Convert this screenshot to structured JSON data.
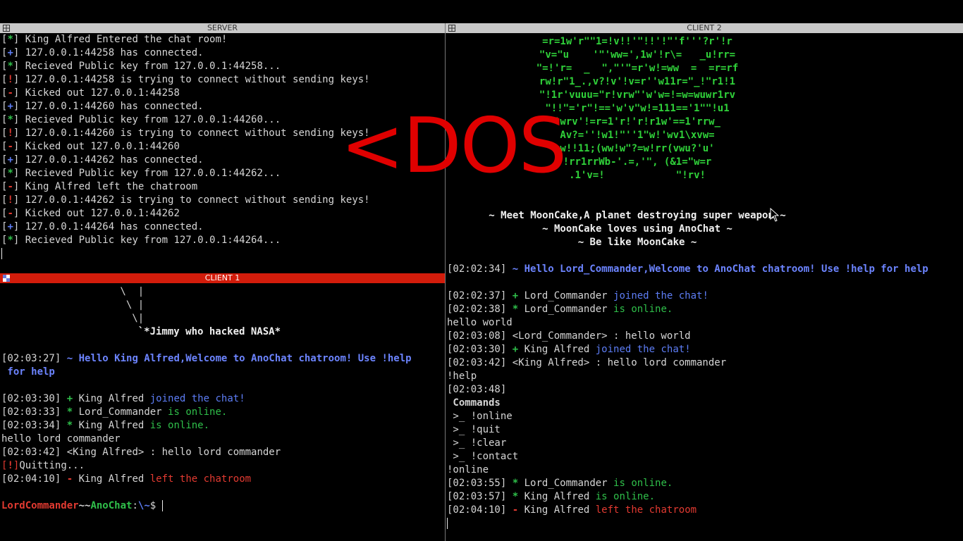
{
  "server": {
    "title": "SERVER",
    "lines": [
      {
        "tag": "*",
        "tag_color": "g",
        "text": "King Alfred Entered the chat room!"
      },
      {
        "tag": "+",
        "tag_color": "b",
        "text": "127.0.0.1:44258 has connected."
      },
      {
        "tag": "*",
        "tag_color": "g",
        "text": "Recieved Public key from 127.0.0.1:44258..."
      },
      {
        "tag": "!",
        "tag_color": "r",
        "text": "127.0.0.1:44258 is trying to connect without sending keys!"
      },
      {
        "tag": "-",
        "tag_color": "r",
        "text": "Kicked out 127.0.0.1:44258"
      },
      {
        "tag": "+",
        "tag_color": "b",
        "text": "127.0.0.1:44260 has connected."
      },
      {
        "tag": "*",
        "tag_color": "g",
        "text": "Recieved Public key from 127.0.0.1:44260..."
      },
      {
        "tag": "!",
        "tag_color": "r",
        "text": "127.0.0.1:44260 is trying to connect without sending keys!"
      },
      {
        "tag": "-",
        "tag_color": "r",
        "text": "Kicked out 127.0.0.1:44260"
      },
      {
        "tag": "+",
        "tag_color": "b",
        "text": "127.0.0.1:44262 has connected."
      },
      {
        "tag": "*",
        "tag_color": "g",
        "text": "Recieved Public key from 127.0.0.1:44262..."
      },
      {
        "tag": "-",
        "tag_color": "r",
        "text": "King Alfred left the chatroom"
      },
      {
        "tag": "!",
        "tag_color": "r",
        "text": "127.0.0.1:44262 is trying to connect without sending keys!"
      },
      {
        "tag": "-",
        "tag_color": "r",
        "text": "Kicked out 127.0.0.1:44262"
      },
      {
        "tag": "+",
        "tag_color": "b",
        "text": "127.0.0.1:44264 has connected."
      },
      {
        "tag": "*",
        "tag_color": "g",
        "text": "Recieved Public key from 127.0.0.1:44264..."
      }
    ]
  },
  "client1": {
    "title": "CLIENT 1",
    "art": [
      " \\  |",
      "  \\ |",
      "   \\|",
      "    `*Jimmy who hacked NASA*"
    ],
    "welcome_time": "[02:03:27]",
    "welcome_line1": " ~ Hello King Alfred,Welcome to AnoChat chatroom! Use !help",
    "welcome_line2": " for help",
    "lines": [
      {
        "time": "[02:03:30]",
        "sym": "+",
        "sym_color": "g",
        "name": " King Alfred",
        "msg": " joined the chat!",
        "msg_color": "b"
      },
      {
        "time": "[02:03:33]",
        "sym": "*",
        "sym_color": "g",
        "name": " Lord_Commander",
        "msg": " is online.",
        "msg_color": "g"
      },
      {
        "time": "[02:03:34]",
        "sym": "*",
        "sym_color": "g",
        "name": " King Alfred",
        "msg": " is online.",
        "msg_color": "g"
      }
    ],
    "typed1": "hello lord commander",
    "msg_time": "[02:03:42]",
    "msg_text": " <King Alfred> : hello lord commander",
    "quit_tag": "!",
    "quit_text": "Quitting...",
    "left_time": "[02:04:10]",
    "left_sym": "-",
    "left_name": " King Alfred",
    "left_msg": " left the chatroom",
    "prompt_user": "LordCommander",
    "prompt_sep": "~~",
    "prompt_host": "AnoChat",
    "prompt_colon": ":",
    "prompt_path": "\\~",
    "prompt_dollar": "$ "
  },
  "client2": {
    "title": "CLIENT 2",
    "art": [
      "=r=1w'r\"\"1=!v!!'\"!!'!\"'f'''?r'!r",
      "\"v=\"u    '\"'ww=',1w'!r\\=   _u!rr=",
      "\"=!'r=  _  \",\"'\"=r'w!=ww  =  =r=rf",
      "rw!r\"1_.,v?!v'!v=r''w11r=\"_!\"r1!1",
      "\"!1r'vuuu=\"r!vrw\"'w'w=!=w=wuwr1rv",
      "\"!!\"='r\"!=='w'v\"w!=111=='1\"\"!u1",
      "'wrv'!=r=1'r!'r!r1w'==1'rrw_",
      "Av?=''!w1!\"''1\"w!'wv1\\xvw=",
      "w!!11;(ww!w\"?=w!rr(vwu?'u'",
      "!rr1rrWb-'.=,'\", (&1=\"w=r",
      ".1'v=!            \"!rv!"
    ],
    "meet": [
      "~ Meet MoonCake,A planet destroying super weapon ~",
      "~ MoonCake loves using AnoChat ~",
      "~ Be like MoonCake ~"
    ],
    "welcome_time": "[02:02:34]",
    "welcome_text": " ~ Hello Lord_Commander,Welcome to AnoChat chatroom! Use !help for help",
    "lines_a": [
      {
        "time": "[02:02:37]",
        "sym": "+",
        "sym_color": "g",
        "name": " Lord_Commander",
        "msg": " joined the chat!",
        "msg_color": "b"
      },
      {
        "time": "[02:02:38]",
        "sym": "*",
        "sym_color": "g",
        "name": " Lord_Commander",
        "msg": " is online.",
        "msg_color": "g"
      }
    ],
    "typed1": "hello world",
    "msg1": "[02:03:08] <Lord_Commander> : hello world",
    "join_time": "[02:03:30]",
    "join_name": " King Alfred",
    "join_msg": " joined the chat!",
    "msg2": "[02:03:42] <King Alfred> : hello lord commander",
    "typed2": "!help",
    "help_time": "[02:03:48]",
    "commands_title": " Commands",
    "commands": [
      " >_ !online",
      " >_ !quit",
      " >_ !clear",
      " >_ !contact"
    ],
    "typed3": "!online",
    "lines_b": [
      {
        "time": "[02:03:55]",
        "sym": "*",
        "sym_color": "g",
        "name": " Lord_Commander",
        "msg": " is online.",
        "msg_color": "g"
      },
      {
        "time": "[02:03:57]",
        "sym": "*",
        "sym_color": "g",
        "name": " King Alfred",
        "msg": " is online.",
        "msg_color": "g"
      },
      {
        "time": "[02:04:10]",
        "sym": "-",
        "sym_color": "r",
        "name": " King Alfred",
        "msg": " left the chatroom",
        "msg_color": "r"
      }
    ]
  },
  "overlay": {
    "text": "<DOS",
    "color": "#e00000"
  },
  "colors": {
    "green": "#2fbf4a",
    "blue": "#5d7df5",
    "red": "#e23a31",
    "active_bar": "#d21c0b",
    "inactive_bar": "#c8c8c8"
  }
}
